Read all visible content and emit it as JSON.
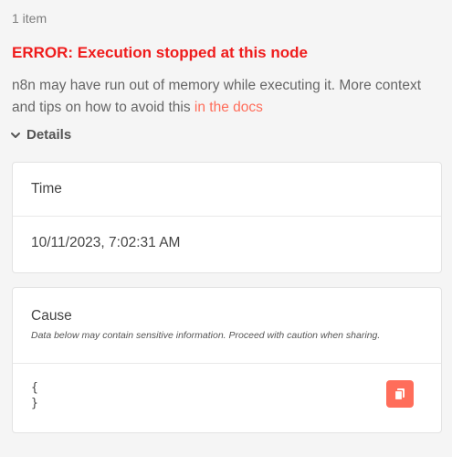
{
  "output": {
    "item_count": "1 item"
  },
  "error": {
    "title": "ERROR: Execution stopped at this node",
    "description_text": "n8n may have run out of memory while executing it. More context and tips on how to avoid this ",
    "docs_link_label": "in the docs"
  },
  "details": {
    "toggle_label": "Details",
    "toggle_icon": "chevron-down-icon",
    "time": {
      "label": "Time",
      "value": "10/11/2023, 7:02:31 AM"
    },
    "cause": {
      "label": "Cause",
      "note": "Data below may contain sensitive information. Proceed with caution when sharing.",
      "json_open": "{",
      "json_close": "}",
      "copy_icon": "copy-icon"
    }
  },
  "colors": {
    "error_red": "#ef1c1c",
    "link_accent": "#ff6d5a",
    "copy_button_bg": "#ff6d5a",
    "background": "#f5f5f5",
    "card_background": "#ffffff"
  }
}
